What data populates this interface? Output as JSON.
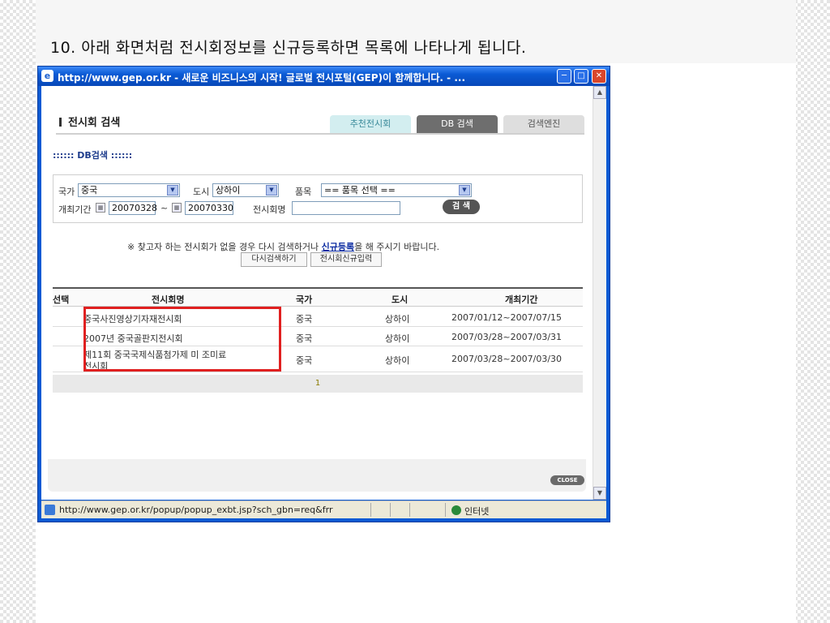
{
  "slide": {
    "title": "10. 아래 화면처럼 전시회정보를 신규등록하면 목록에 나타나게 됩니다."
  },
  "window": {
    "title": "http://www.gep.or.kr - 새로운 비즈니스의 시작! 글로벌 전시포털(GEP)이 함께합니다. - ...",
    "status_url": "http://www.gep.or.kr/popup/popup_exbt.jsp?sch_gbn=req&frr",
    "status_zone": "인터넷"
  },
  "page": {
    "section_title": "전시회 검색",
    "tabs": [
      "추천전시회",
      "DB 검색",
      "검색엔진"
    ],
    "sub_title": ":::::: DB검색 ::::::",
    "search": {
      "country_label": "국가",
      "country_value": "중국",
      "city_label": "도시",
      "city_value": "상하이",
      "item_label": "품목",
      "item_value": "== 품목 선택 ==",
      "period_label": "개최기간",
      "date_from": "20070328",
      "tilde": "~",
      "date_to": "20070330",
      "name_label": "전시회명",
      "name_value": "",
      "search_button": "검 색"
    },
    "notice_pre": "※ 찾고자 하는 전시회가 없을 경우 다시 검색하거나 ",
    "notice_link": "신규등록",
    "notice_post": "을 해 주시기 바랍니다.",
    "buttons": {
      "research": "다시검색하기",
      "register": "전시회신규입력"
    },
    "table": {
      "headers": [
        "선택",
        "전시회명",
        "국가",
        "도시",
        "개최기간"
      ],
      "rows": [
        {
          "name": "중국사진영상기자재전시회",
          "country": "중국",
          "city": "상하이",
          "period": "2007/01/12~2007/07/15"
        },
        {
          "name": "2007년 중국골판지전시회",
          "country": "중국",
          "city": "상하이",
          "period": "2007/03/28~2007/03/31"
        },
        {
          "name": "제11회 중국국제식품첨가제 미 조미료",
          "name2": "전시회",
          "country": "중국",
          "city": "상하이",
          "period": "2007/03/28~2007/03/30"
        }
      ],
      "page_number": "1"
    },
    "close_button": "CLOSE"
  },
  "colors": {
    "highlight": "#e02020",
    "titlebar": "#0a5ad4",
    "link": "#0a2aa0"
  }
}
